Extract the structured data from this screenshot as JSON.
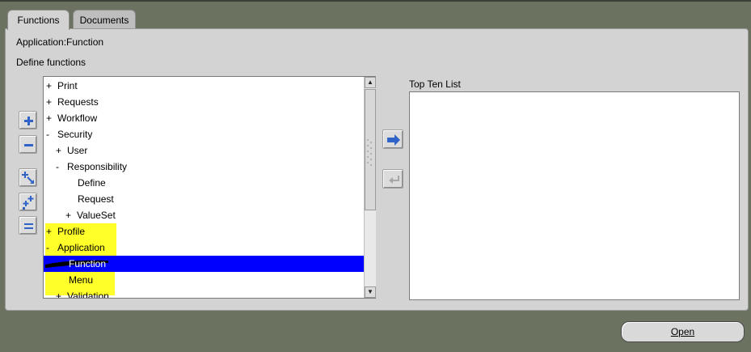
{
  "tabs": [
    {
      "label": "Functions",
      "active": true
    },
    {
      "label": "Documents",
      "active": false
    }
  ],
  "header": {
    "title": "Application:Function",
    "section_label": "Define functions"
  },
  "tree": {
    "nodes": [
      {
        "expander": "+",
        "label": "Print",
        "level": 0
      },
      {
        "expander": "+",
        "label": "Requests",
        "level": 0
      },
      {
        "expander": "+",
        "label": "Workflow",
        "level": 0
      },
      {
        "expander": "-",
        "label": "Security",
        "level": 0
      },
      {
        "expander": "+",
        "label": "User",
        "level": 1
      },
      {
        "expander": "-",
        "label": "Responsibility",
        "level": 1
      },
      {
        "expander": "",
        "label": "Define",
        "level": 2
      },
      {
        "expander": "",
        "label": "Request",
        "level": 2
      },
      {
        "expander": "+",
        "label": "ValueSet",
        "level": 2
      },
      {
        "expander": "+",
        "label": "Profile",
        "level": 0
      },
      {
        "expander": "-",
        "label": "Application",
        "level": 0
      },
      {
        "expander": "",
        "label": "Function",
        "level": 1,
        "selected": true
      },
      {
        "expander": "",
        "label": "Menu",
        "level": 1
      },
      {
        "expander": "+",
        "label": "Validation",
        "level": 1
      }
    ],
    "highlight_color": "#ffff2a",
    "selection_color": "#0000ff"
  },
  "top_ten": {
    "label": "Top Ten List"
  },
  "actions": {
    "open_label": "Open"
  },
  "icons": {
    "expand": "plus-icon",
    "collapse": "minus-icon",
    "expand_all": "expand-branch-icon",
    "expand_all_children": "expand-all-icon",
    "collapse_all": "collapse-all-icon",
    "add_to_list": "arrow-right-icon",
    "remove_from_list": "arrow-left-icon"
  }
}
